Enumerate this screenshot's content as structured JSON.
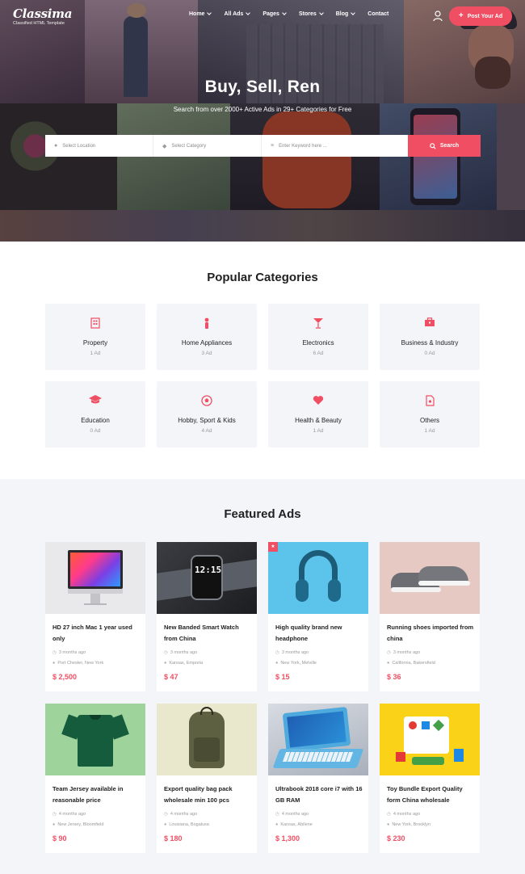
{
  "logo": {
    "name": "Classima",
    "tagline": "Classified HTML Template"
  },
  "nav": {
    "items": [
      {
        "label": "Home",
        "dropdown": true
      },
      {
        "label": "All Ads",
        "dropdown": true
      },
      {
        "label": "Pages",
        "dropdown": true
      },
      {
        "label": "Stores",
        "dropdown": true
      },
      {
        "label": "Blog",
        "dropdown": true
      },
      {
        "label": "Contact",
        "dropdown": false
      }
    ],
    "post_button": "Post Your Ad",
    "user_icon": "user-icon"
  },
  "hero": {
    "title": "Buy, Sell, Ren",
    "subtitle": "Search from over 2000+ Active Ads in 29+ Categories for Free"
  },
  "search": {
    "location_placeholder": "Select Location",
    "category_placeholder": "Select Category",
    "keyword_placeholder": "Enter Keyword here ...",
    "button_label": "Search"
  },
  "categories": {
    "title": "Popular Categories",
    "items": [
      {
        "name": "Property",
        "count": "1 Ad",
        "icon": "building-icon"
      },
      {
        "name": "Home Appliances",
        "count": "3 Ad",
        "icon": "lamp-icon"
      },
      {
        "name": "Electronics",
        "count": "6 Ad",
        "icon": "glass-icon"
      },
      {
        "name": "Business & Industry",
        "count": "0 Ad",
        "icon": "briefcase-icon"
      },
      {
        "name": "Education",
        "count": "0 Ad",
        "icon": "graduation-cap-icon"
      },
      {
        "name": "Hobby, Sport & Kids",
        "count": "4 Ad",
        "icon": "ball-icon"
      },
      {
        "name": "Health & Beauty",
        "count": "1 Ad",
        "icon": "heart-icon"
      },
      {
        "name": "Others",
        "count": "1 Ad",
        "icon": "document-icon"
      }
    ]
  },
  "featured": {
    "title": "Featured Ads",
    "ads": [
      {
        "title": "HD 27 inch Mac 1 year used only",
        "time": "3 months ago",
        "location": "Port Chester, New York",
        "price": "$ 2,500"
      },
      {
        "title": "New Banded Smart Watch from China",
        "time": "3 months ago",
        "location": "Kansas, Emporia",
        "price": "$ 47",
        "watch_time": "12:15"
      },
      {
        "title": "High quality brand new headphone",
        "time": "3 months ago",
        "location": "New York, Melville",
        "price": "$ 15"
      },
      {
        "title": "Running shoes imported from china",
        "time": "3 months ago",
        "location": "California, Bakersfield",
        "price": "$ 36"
      },
      {
        "title": "Team Jersey available in reasonable price",
        "time": "4 months ago",
        "location": "New Jersey, Bloomfield",
        "price": "$ 90"
      },
      {
        "title": "Export quality bag pack wholesale min 100 pcs",
        "time": "4 months ago",
        "location": "Louisiana, Bogalusa",
        "price": "$ 180"
      },
      {
        "title": "Ultrabook 2018 core i7 with 16 GB RAM",
        "time": "4 months ago",
        "location": "Kansas, Abilene",
        "price": "$ 1,300"
      },
      {
        "title": "Toy Bundle Export Quality form China wholesale",
        "time": "4 months ago",
        "location": "New York, Brooklyn",
        "price": "$ 230"
      }
    ]
  },
  "colors": {
    "accent": "#f04e62",
    "card_bg": "#f4f5f9"
  }
}
